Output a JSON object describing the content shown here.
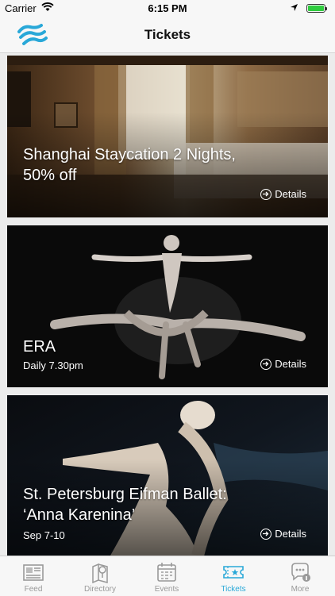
{
  "status_bar": {
    "carrier": "Carrier",
    "time": "6:15 PM",
    "battery_level": 1.0,
    "battery_color": "#2fcc3f"
  },
  "nav": {
    "title": "Tickets",
    "logo_icon": "brand-logo-icon"
  },
  "cards": [
    {
      "title": "Shanghai Staycation 2 Nights, 50% off",
      "title_line1": "Shanghai Staycation 2 Nights,",
      "title_line2": "50% off",
      "subtitle": "",
      "details_label": "Details"
    },
    {
      "title": "ERA",
      "subtitle": "Daily 7.30pm",
      "details_label": "Details"
    },
    {
      "title_line1": "St. Petersburg Eifman Ballet:",
      "title_line2": "‘Anna Karenina’",
      "subtitle": "Sep 7-10",
      "details_label": "Details"
    }
  ],
  "tab_bar": {
    "active_color": "#29a8d8",
    "items": [
      {
        "label": "Feed",
        "icon": "newspaper-icon"
      },
      {
        "label": "Directory",
        "icon": "map-pin-icon"
      },
      {
        "label": "Events",
        "icon": "calendar-icon"
      },
      {
        "label": "Tickets",
        "icon": "ticket-icon",
        "active": true
      },
      {
        "label": "More",
        "icon": "chat-info-icon"
      }
    ]
  }
}
